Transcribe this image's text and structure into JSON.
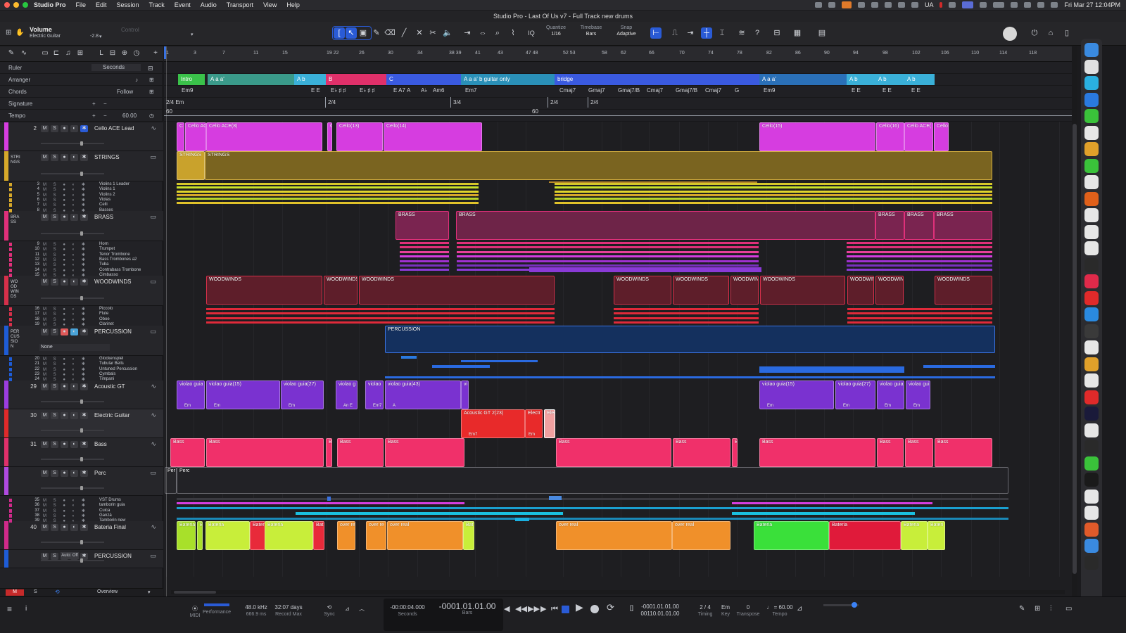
{
  "menubar": {
    "app": "Studio Pro",
    "items": [
      "File",
      "Edit",
      "Session",
      "Track",
      "Event",
      "Audio",
      "Transport",
      "View",
      "Help"
    ],
    "clock": "Fri Mar 27  12:04PM",
    "lang": "UA"
  },
  "window": {
    "title": "Studio Pro - Last Of Us v7 - Full Track new drums"
  },
  "toolbar": {
    "param_name": "Volume",
    "param_sub": "Electric Guitar",
    "param_val": "-2.8",
    "control": "Control",
    "quantize_label": "Quantize",
    "quantize_val": "1/16",
    "timebase_label": "Timebase",
    "timebase_val": "Bars",
    "snap_label": "Snap",
    "snap_val": "Adaptive"
  },
  "globals": {
    "ruler": "Ruler",
    "ruler_val": "Seconds",
    "arranger": "Arranger",
    "chords": "Chords",
    "chords_val": "Follow",
    "signature": "Signature",
    "tempo": "Tempo",
    "tempo_val": "60.00"
  },
  "ruler": {
    "bars": [
      "1",
      "3",
      "7",
      "11",
      "15",
      "19 22",
      "26",
      "30",
      "34",
      "38 39",
      "41",
      "43",
      "47 48",
      "52 53",
      "58",
      "62",
      "66",
      "70",
      "74",
      "78",
      "82",
      "86",
      "90",
      "94",
      "98",
      "102",
      "106",
      "110",
      "114",
      "118"
    ],
    "times": [
      "0",
      "20",
      "40",
      "1:00",
      "1:20",
      "1:40",
      "2:00",
      "2:20",
      "2:40",
      "3:00",
      "3:20"
    ]
  },
  "arranger": [
    "Intro",
    "A a a'",
    "A b",
    "B",
    "C",
    "A a a' b guitar only",
    "bridge",
    "A a a'",
    "A b",
    "A b",
    "A b"
  ],
  "chords": [
    "Em9",
    "E E",
    "E♭ ♯ ♯",
    "E♭ ♯ ♯",
    "E A7",
    "A",
    "A♭",
    "Am6",
    "Em7",
    "Cmaj7",
    "Gmaj7",
    "Gmaj7/B",
    "Cmaj7",
    "Gmaj7/B",
    "Cmaj7",
    "G",
    "Em9",
    "E E",
    "E E",
    "E E"
  ],
  "signature": {
    "first": "2/4  Em",
    "marks": [
      "2/4",
      "3/4",
      "2/4",
      "2/4"
    ],
    "tempo": "60",
    "tempo_mid": "60"
  },
  "tracks": [
    {
      "num": "2",
      "name": "Cello ACE Lead",
      "color": "#d63de0"
    },
    {
      "num": "",
      "name": "STRINGS",
      "color": "#d6a82a",
      "vtxt": "STRINGS"
    },
    {
      "num": "",
      "name": "BRASS",
      "color": "#e0307a",
      "vtxt": "BRASS"
    },
    {
      "num": "",
      "name": "WOODWINDS",
      "color": "#d6304a",
      "vtxt": "WOODWINDS"
    },
    {
      "num": "",
      "name": "PERCUSSION",
      "color": "#1e5cd6",
      "vtxt": "PERCUSSION",
      "sel": "None"
    },
    {
      "num": "29",
      "name": "Acoustic GT",
      "color": "#9b3de0"
    },
    {
      "num": "30",
      "name": "Electric Guitar",
      "color": "#e02a2a"
    },
    {
      "num": "31",
      "name": "Bass",
      "color": "#e0306a"
    },
    {
      "num": "",
      "name": "Perc",
      "color": "#b04ae0"
    },
    {
      "num": "40",
      "name": "Bateria Final",
      "color": "#d02a8a"
    },
    {
      "num": "",
      "name": "PERCUSSION",
      "color": "#1e5cd6",
      "auto": "Auto: Off"
    }
  ],
  "subtracks": {
    "strings": [
      [
        "3",
        "Violins 1 Leader"
      ],
      [
        "4",
        "Violins 1"
      ],
      [
        "5",
        "Violins 2"
      ],
      [
        "6",
        "Violas"
      ],
      [
        "7",
        "Celli"
      ],
      [
        "8",
        "Basses"
      ]
    ],
    "brass": [
      [
        "9",
        "Horn"
      ],
      [
        "10",
        "Trumpet"
      ],
      [
        "11",
        "Tenor Trombone"
      ],
      [
        "12",
        "Bass Trombones a2"
      ],
      [
        "13",
        "Tuba"
      ],
      [
        "14",
        "Contrabass Trombone"
      ],
      [
        "15",
        "Cimbasso"
      ]
    ],
    "woodwinds": [
      [
        "16",
        "Piccolo"
      ],
      [
        "17",
        "Flute"
      ],
      [
        "18",
        "Oboe"
      ],
      [
        "19",
        "Clarinet"
      ]
    ],
    "percussion": [
      [
        "20",
        "Glockenspiel"
      ],
      [
        "21",
        "Tubular Bells"
      ],
      [
        "22",
        "Untuned Percussion"
      ],
      [
        "23",
        "Cymbals"
      ],
      [
        "24",
        "Timpani"
      ]
    ],
    "drums": [
      [
        "35",
        "VST Drums"
      ],
      [
        "36",
        "tamborin guia"
      ],
      [
        "37",
        "Cuica"
      ],
      [
        "38",
        "Ganzá"
      ],
      [
        "39",
        "Tamborin new"
      ]
    ]
  },
  "clips": {
    "cello": [
      "C",
      "Cello AC",
      "Cello ACE(8)",
      "C",
      "Cello(13)",
      "Cello(14)",
      "Cello(15)",
      "Cello(16)",
      "Cello ACE(",
      "Cello"
    ],
    "strings": [
      "STRINGS",
      "STRINGS"
    ],
    "brass": [
      "BRASS",
      "BRASS",
      "BRASS",
      "BRASS",
      "BRASS"
    ],
    "woodwinds": [
      "WOODWINDS",
      "WOODWINDS",
      "WOODWINDS",
      "WOODWINDS",
      "WOODWINDS",
      "WOODWIN",
      "WOODWINDS",
      "WOODWIN",
      "WOODWIN",
      "WOODWINDS"
    ],
    "percussion": "PERCUSSION",
    "acgt": [
      "violao guia",
      "violao guia(15)",
      "violao guia(27)",
      "violao g",
      "violao",
      "violao guia(43)",
      "vi",
      "violao guia(15)",
      "violao guia(27)",
      "violao guia",
      "violao gui"
    ],
    "acgt_sub": [
      "Em",
      "Em",
      "Em",
      "An E",
      "Em7",
      "A",
      "Am7",
      "Em",
      "Em",
      "Em",
      "Em"
    ],
    "egt": [
      "Acoustic GT 2(23)",
      "Electr",
      "Elec"
    ],
    "egt_sub": [
      "Em7",
      "Em"
    ],
    "bass": [
      "Bass",
      "Bass",
      "Bass",
      "Bass",
      "Bass",
      "Bass",
      "Bass",
      "Bass",
      "Bass",
      "Bass"
    ],
    "perc": [
      "Per",
      "Perc"
    ],
    "bateria": [
      "Bateria",
      "Bateria",
      "Bater",
      "Bateria",
      "Bat",
      "over re",
      "over re",
      "over real",
      "Batr",
      "over real",
      "over real",
      "Bateria",
      "Bateria",
      "Bateria",
      "Bateri"
    ]
  },
  "footer_left": {
    "overview": "Overview",
    "m": "M",
    "s": "S"
  },
  "transport": {
    "midi": "MIDI",
    "performance": "Performance",
    "rate": "48.0 kHz",
    "latency": "666.9 ms",
    "days": "32:07 days",
    "record_max": "Record Max",
    "sync": "Sync",
    "time1": "-00:00:04.000",
    "time1_unit": "Seconds",
    "time2": "-0001.01.01.00",
    "time2_unit": "Bars",
    "loop_l": "-0001.01.01.00",
    "loop_r": "00110.01.01.00",
    "sig": "2 / 4",
    "sig_label": "Timing",
    "key": "Em",
    "key_label": "Key",
    "transpose": "0",
    "transpose_label": "Transpose",
    "tempo": "♩ = 60.00",
    "tempo_label": "Tempo"
  },
  "colors": {
    "accent": "#2a5bd6",
    "strings": "#c9a22c",
    "brass": "#7a2450",
    "woodwinds": "#6a2030",
    "percussion": "#14305e",
    "cello": "#d63de0",
    "acgt": "#9b3de0",
    "bass": "#f0306a",
    "egt": "#e82a2a"
  }
}
